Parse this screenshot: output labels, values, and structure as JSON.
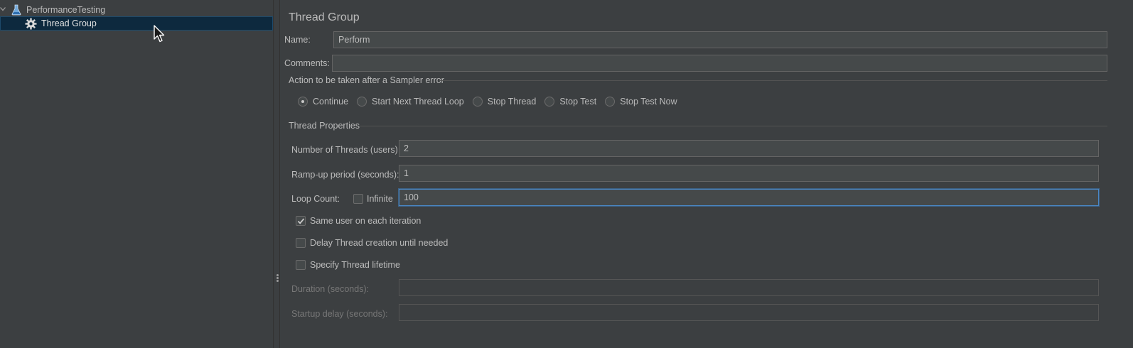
{
  "tree": {
    "root_label": "PerformanceTesting",
    "root_icon": "flask-icon",
    "child_label": "Thread Group",
    "child_icon": "gear-icon"
  },
  "panel": {
    "title": "Thread Group",
    "name_label": "Name:",
    "name_value": "Perform",
    "comments_label": "Comments:",
    "comments_value": ""
  },
  "sampler_error": {
    "title": "Action to be taken after a Sampler error",
    "options": [
      "Continue",
      "Start Next Thread Loop",
      "Stop Thread",
      "Stop Test",
      "Stop Test Now"
    ],
    "selected": "Continue"
  },
  "thread_properties": {
    "title": "Thread Properties",
    "threads_label": "Number of Threads (users):",
    "threads_value": "2",
    "rampup_label": "Ramp-up period (seconds):",
    "rampup_value": "1",
    "loop_label": "Loop Count:",
    "infinite_label": "Infinite",
    "infinite_checked": false,
    "loop_value": "100",
    "same_user_label": "Same user on each iteration",
    "same_user_checked": true,
    "delay_label": "Delay Thread creation until needed",
    "delay_checked": false,
    "lifetime_label": "Specify Thread lifetime",
    "lifetime_checked": false,
    "duration_label": "Duration (seconds):",
    "duration_value": "",
    "startup_label": "Startup delay (seconds):",
    "startup_value": ""
  },
  "colors": {
    "background": "#3c3f41",
    "selection": "#0d293e",
    "input_bg": "#45494a",
    "focus_border": "#4a88c7",
    "text": "#bbbbbb"
  }
}
